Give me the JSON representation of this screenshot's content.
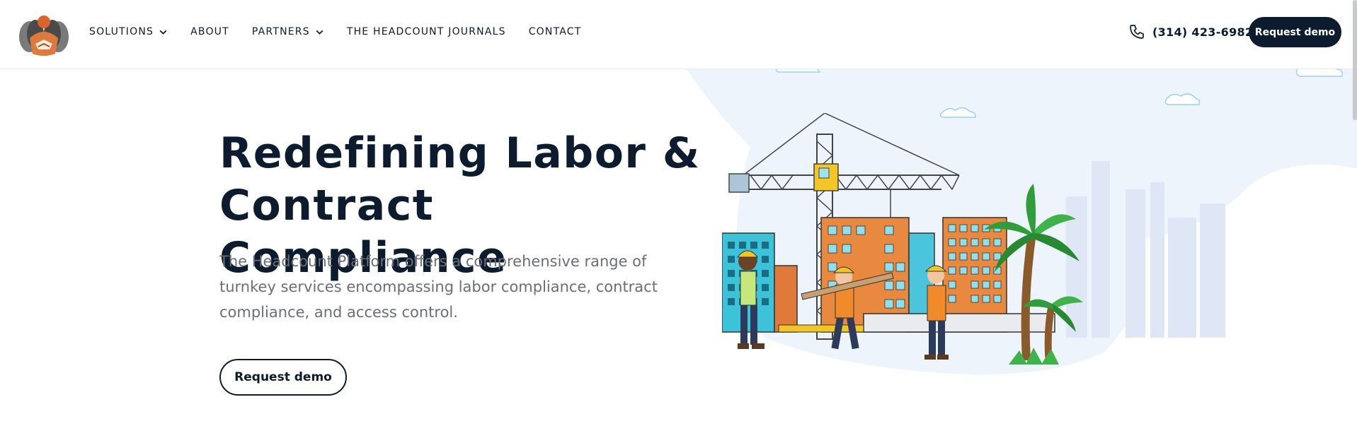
{
  "header": {
    "logo_icon": "headcount-logo",
    "nav": [
      {
        "label": "SOLUTIONS",
        "has_dropdown": true
      },
      {
        "label": "ABOUT",
        "has_dropdown": false
      },
      {
        "label": "PARTNERS",
        "has_dropdown": true
      },
      {
        "label": "THE HEADCOUNT JOURNALS",
        "has_dropdown": false
      },
      {
        "label": "CONTACT",
        "has_dropdown": false
      }
    ],
    "phone": "(314) 423-6982",
    "phone_icon": "phone-icon",
    "cta_label": "Request demo"
  },
  "hero": {
    "title_line1": "Redefining Labor &",
    "title_line2": "Contract Compliance",
    "description": "The Headcount Platform offers a comprehensive range of turnkey services encompassing labor compliance, contract compliance, and access control.",
    "cta_label": "Request demo",
    "illustration": "construction-site-illustration"
  },
  "colors": {
    "primary": "#0d1b2e",
    "body_text": "#6b6f75",
    "hero_bg": "#eef4fb",
    "accent_orange": "#e07a3a"
  }
}
